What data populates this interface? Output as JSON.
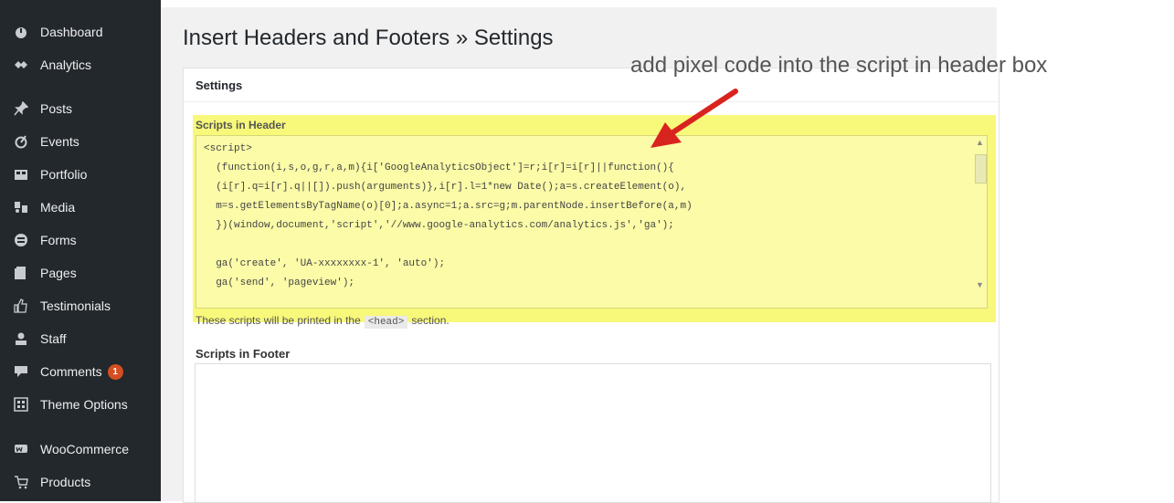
{
  "sidebar": {
    "items": [
      {
        "label": "Dashboard",
        "icon": "dashboard-icon"
      },
      {
        "label": "Analytics",
        "icon": "analytics-icon"
      },
      {
        "label": "Posts",
        "icon": "pin-icon"
      },
      {
        "label": "Events",
        "icon": "events-icon"
      },
      {
        "label": "Portfolio",
        "icon": "portfolio-icon"
      },
      {
        "label": "Media",
        "icon": "media-icon"
      },
      {
        "label": "Forms",
        "icon": "forms-icon"
      },
      {
        "label": "Pages",
        "icon": "pages-icon"
      },
      {
        "label": "Testimonials",
        "icon": "thumbs-up-icon"
      },
      {
        "label": "Staff",
        "icon": "user-icon"
      },
      {
        "label": "Comments",
        "icon": "comment-icon",
        "badge": "1"
      },
      {
        "label": "Theme Options",
        "icon": "theme-options-icon"
      },
      {
        "label": "WooCommerce",
        "icon": "woocommerce-icon"
      },
      {
        "label": "Products",
        "icon": "cart-icon"
      }
    ]
  },
  "page": {
    "title": "Insert Headers and Footers » Settings"
  },
  "settings": {
    "card_title": "Settings",
    "header_label": "Scripts in Header",
    "header_code": "<script>\n  (function(i,s,o,g,r,a,m){i['GoogleAnalyticsObject']=r;i[r]=i[r]||function(){\n  (i[r].q=i[r].q||[]).push(arguments)},i[r].l=1*new Date();a=s.createElement(o),\n  m=s.getElementsByTagName(o)[0];a.async=1;a.src=g;m.parentNode.insertBefore(a,m)\n  })(window,document,'script','//www.google-analytics.com/analytics.js','ga');\n\n  ga('create', 'UA-xxxxxxxx-1', 'auto');\n  ga('send', 'pageview');",
    "header_note_before": "These scripts will be printed in the",
    "header_note_code": "<head>",
    "header_note_after": "section.",
    "footer_label": "Scripts in Footer",
    "footer_code": ""
  },
  "annotation": {
    "text": "add pixel code into the script in header box",
    "color": "#d9231f"
  },
  "colors": {
    "sidebar_bg": "#23282d",
    "highlight": "#f8f87a",
    "badge": "#d54e21"
  }
}
